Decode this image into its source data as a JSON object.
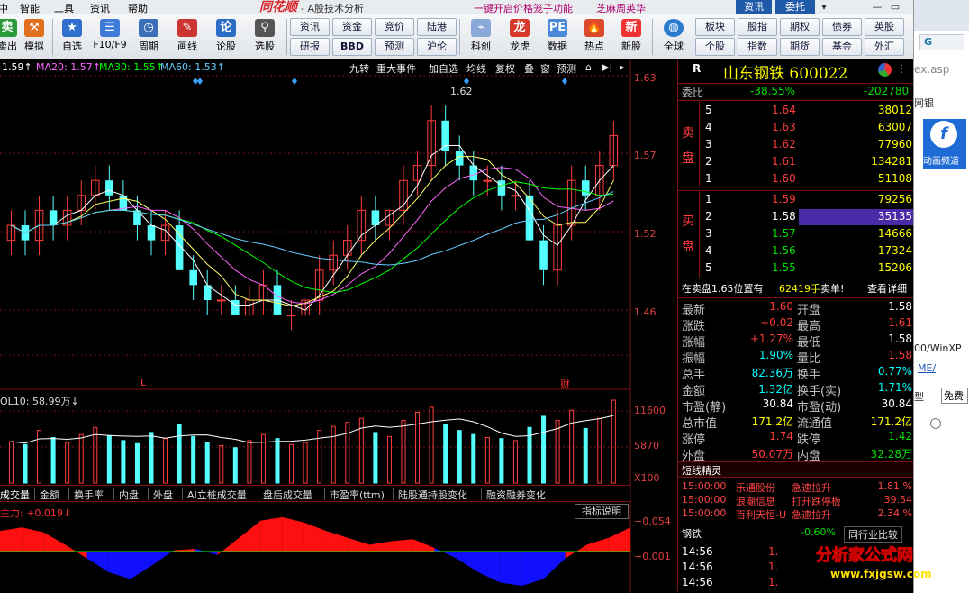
{
  "menu": {
    "items": [
      "中",
      "智能",
      "工具",
      "资讯",
      "帮助"
    ],
    "brand": "同花顺",
    "title": "- A股技术分析",
    "promo1": "一键开启价格笼子功能",
    "promo2": "芝麻周英华"
  },
  "topright": {
    "news": "资讯",
    "entrust": "委托"
  },
  "toolbar": {
    "buttons": [
      {
        "label": "卖出",
        "icon": "sell-icon"
      },
      {
        "label": "模拟",
        "icon": "simulate-icon"
      },
      {
        "label": "自选",
        "icon": "watchlist-icon"
      },
      {
        "label": "F10/F9",
        "icon": "f10-icon"
      },
      {
        "label": "周期",
        "icon": "period-icon"
      },
      {
        "label": "画线",
        "icon": "draw-line-icon"
      },
      {
        "label": "论股",
        "icon": "forum-icon"
      },
      {
        "label": "选股",
        "icon": "stock-picker-icon"
      }
    ],
    "small_top": [
      "资讯",
      "资金",
      "竞价",
      "陆港"
    ],
    "small_bottom": [
      "研报",
      "BBD",
      "预测",
      "沪伦"
    ],
    "buttons2": [
      {
        "label": "科创",
        "icon": "star-market-icon"
      },
      {
        "label": "龙虎",
        "icon": "dragon-tiger-icon"
      },
      {
        "label": "数据",
        "icon": "data-icon"
      },
      {
        "label": "热点",
        "icon": "hot-icon"
      },
      {
        "label": "新股",
        "icon": "new-stock-icon"
      }
    ],
    "global": {
      "label": "全球",
      "icon": "globe-icon"
    },
    "right_top": [
      "板块",
      "股指",
      "期权",
      "债券",
      "英股"
    ],
    "right_bottom": [
      "个股",
      "指数",
      "期货",
      "基金",
      "外汇"
    ]
  },
  "chart": {
    "ma_labels": [
      {
        "text": "1.59↑",
        "color": "#ffffff"
      },
      {
        "text": "MA20: 1.57↑",
        "color": "#ff66ff"
      },
      {
        "text": "MA30: 1.55↑",
        "color": "#00ff00"
      },
      {
        "text": "MA60: 1.53↑",
        "color": "#66ccff"
      }
    ],
    "tools": [
      "九转",
      "重大事件",
      "加自选",
      "均线",
      "复权",
      "叠",
      "窗",
      "预测"
    ],
    "price_axis": [
      "1.63",
      "1.57",
      "1.52",
      "1.46"
    ],
    "peak_label": "1.62",
    "markers": [
      "L",
      "财"
    ],
    "vol_label": "OL10: 58.99万↓",
    "vol_axis": [
      "11600",
      "5870",
      "X100"
    ],
    "tabs": [
      "成交量",
      "金额",
      "换手率",
      "内盘",
      "外盘",
      "AI立桩成交量",
      "盘后成交量",
      "市盈率(ttm)",
      "陆股通持股变化",
      "融资融券变化"
    ],
    "flow_label": "主力: +0.019↓",
    "flow_help": "指标说明",
    "flow_axis": [
      "+0.054",
      "+0.001"
    ]
  },
  "chart_data": {
    "type": "candlestick",
    "title": "山东钢铁 600022",
    "ylim": [
      1.44,
      1.64
    ],
    "candles": [
      [
        1.53,
        1.55,
        1.52,
        1.54
      ],
      [
        1.54,
        1.55,
        1.52,
        1.53
      ],
      [
        1.53,
        1.56,
        1.52,
        1.55
      ],
      [
        1.55,
        1.56,
        1.53,
        1.54
      ],
      [
        1.54,
        1.56,
        1.53,
        1.55
      ],
      [
        1.55,
        1.57,
        1.54,
        1.56
      ],
      [
        1.56,
        1.58,
        1.55,
        1.57
      ],
      [
        1.57,
        1.58,
        1.55,
        1.56
      ],
      [
        1.56,
        1.57,
        1.55,
        1.55
      ],
      [
        1.55,
        1.56,
        1.53,
        1.54
      ],
      [
        1.54,
        1.55,
        1.52,
        1.53
      ],
      [
        1.53,
        1.55,
        1.52,
        1.54
      ],
      [
        1.54,
        1.55,
        1.51,
        1.51
      ],
      [
        1.51,
        1.52,
        1.49,
        1.5
      ],
      [
        1.5,
        1.51,
        1.48,
        1.49
      ],
      [
        1.49,
        1.5,
        1.48,
        1.49
      ],
      [
        1.49,
        1.5,
        1.48,
        1.48
      ],
      [
        1.48,
        1.5,
        1.48,
        1.49
      ],
      [
        1.49,
        1.51,
        1.48,
        1.5
      ],
      [
        1.5,
        1.51,
        1.48,
        1.48
      ],
      [
        1.48,
        1.49,
        1.47,
        1.48
      ],
      [
        1.48,
        1.49,
        1.48,
        1.49
      ],
      [
        1.49,
        1.52,
        1.48,
        1.51
      ],
      [
        1.51,
        1.53,
        1.5,
        1.52
      ],
      [
        1.52,
        1.54,
        1.51,
        1.53
      ],
      [
        1.53,
        1.56,
        1.52,
        1.55
      ],
      [
        1.55,
        1.56,
        1.53,
        1.54
      ],
      [
        1.54,
        1.55,
        1.53,
        1.55
      ],
      [
        1.55,
        1.58,
        1.54,
        1.57
      ],
      [
        1.57,
        1.59,
        1.56,
        1.58
      ],
      [
        1.58,
        1.62,
        1.57,
        1.61
      ],
      [
        1.61,
        1.62,
        1.58,
        1.59
      ],
      [
        1.59,
        1.6,
        1.57,
        1.58
      ],
      [
        1.58,
        1.59,
        1.56,
        1.57
      ],
      [
        1.57,
        1.58,
        1.56,
        1.57
      ],
      [
        1.57,
        1.58,
        1.55,
        1.56
      ],
      [
        1.56,
        1.57,
        1.55,
        1.56
      ],
      [
        1.56,
        1.57,
        1.53,
        1.53
      ],
      [
        1.53,
        1.54,
        1.5,
        1.51
      ],
      [
        1.51,
        1.55,
        1.5,
        1.54
      ],
      [
        1.54,
        1.58,
        1.53,
        1.57
      ],
      [
        1.57,
        1.58,
        1.55,
        1.56
      ],
      [
        1.56,
        1.59,
        1.55,
        1.58
      ],
      [
        1.58,
        1.61,
        1.57,
        1.6
      ]
    ],
    "volume": [
      41,
      38,
      52,
      45,
      40,
      48,
      55,
      47,
      42,
      39,
      50,
      44,
      58,
      46,
      40,
      37,
      35,
      42,
      48,
      44,
      38,
      40,
      52,
      56,
      60,
      64,
      50,
      46,
      62,
      70,
      75,
      58,
      52,
      48,
      45,
      44,
      42,
      55,
      66,
      62,
      72,
      54,
      64,
      82
    ],
    "flow": [
      0.03,
      0.035,
      0.028,
      0.01,
      -0.01,
      -0.03,
      -0.04,
      -0.02,
      0.002,
      0.004,
      -0.005,
      0.02,
      0.045,
      0.05,
      0.042,
      0.03,
      0.02,
      0.01,
      0.015,
      0.018,
      0.005,
      -0.01,
      -0.03,
      -0.045,
      -0.05,
      -0.04,
      -0.01,
      0.01,
      0.02,
      0.035
    ]
  },
  "quote": {
    "name": "山东钢铁 600022",
    "R": "R",
    "webi": {
      "label": "委比",
      "pct": "-38.55%",
      "diff": "-202780"
    },
    "sell_side": "卖盘",
    "buy_side": "买盘",
    "asks": [
      {
        "lv": "5",
        "p": "1.64",
        "v": "38012"
      },
      {
        "lv": "4",
        "p": "1.63",
        "v": "63007"
      },
      {
        "lv": "3",
        "p": "1.62",
        "v": "77960"
      },
      {
        "lv": "2",
        "p": "1.61",
        "v": "134281"
      },
      {
        "lv": "1",
        "p": "1.60",
        "v": "51108"
      }
    ],
    "bids": [
      {
        "lv": "1",
        "p": "1.59",
        "v": "79256"
      },
      {
        "lv": "2",
        "p": "1.58",
        "v": "35135"
      },
      {
        "lv": "3",
        "p": "1.57",
        "v": "14666"
      },
      {
        "lv": "4",
        "p": "1.56",
        "v": "17324"
      },
      {
        "lv": "5",
        "p": "1.55",
        "v": "15206"
      }
    ],
    "bigorder": {
      "a": "在卖盘1.65位置有",
      "b": "62419手",
      "c": "卖单!",
      "d": "查看详细"
    },
    "stats": [
      [
        "最新",
        "1.60",
        "red",
        "开盘",
        "1.58",
        "white"
      ],
      [
        "涨跌",
        "+0.02",
        "red",
        "最高",
        "1.61",
        "red"
      ],
      [
        "涨幅",
        "+1.27%",
        "red",
        "最低",
        "1.58",
        "white"
      ],
      [
        "振幅",
        "1.90%",
        "cyan",
        "量比",
        "1.58",
        "red"
      ],
      [
        "总手",
        "82.36万",
        "cyan",
        "换手",
        "0.77%",
        "cyan"
      ],
      [
        "金额",
        "1.32亿",
        "cyan",
        "换手(实)",
        "1.71%",
        "cyan"
      ],
      [
        "市盈(静)",
        "30.84",
        "white",
        "市盈(动)",
        "30.84",
        "white"
      ],
      [
        "总市值",
        "171.2亿",
        "yellow",
        "流通值",
        "171.2亿",
        "yellow"
      ],
      [
        "涨停",
        "1.74",
        "red",
        "跌停",
        "1.42",
        "green"
      ],
      [
        "外盘",
        "50.07万",
        "red",
        "内盘",
        "32.28万",
        "green"
      ]
    ],
    "genie_title": "短线精灵",
    "genie": [
      [
        "15:00:00",
        "乐通股份",
        "急速拉升",
        "1.81 %"
      ],
      [
        "15:00:00",
        "浪潮信息",
        "打开跌停板",
        "39.54"
      ],
      [
        "15:00:00",
        "百利天恒-U",
        "急速拉升",
        "2.34 %"
      ]
    ],
    "industry": {
      "name": "钢铁",
      "pct": "-0.60%",
      "compare": "同行业比较"
    },
    "ticks": [
      [
        "14:56",
        "1."
      ],
      [
        "14:56",
        "1."
      ],
      [
        "14:56",
        "1."
      ]
    ]
  },
  "watermark": {
    "text": "分析家公式网",
    "url": "www.fxjgsw.com"
  },
  "browser": {
    "url_frag": "ex.asp",
    "bank": "网银",
    "flash": "动画频道",
    "win": "00/WinXP",
    "me": "ME/",
    "type": "型",
    "free": "免费"
  }
}
